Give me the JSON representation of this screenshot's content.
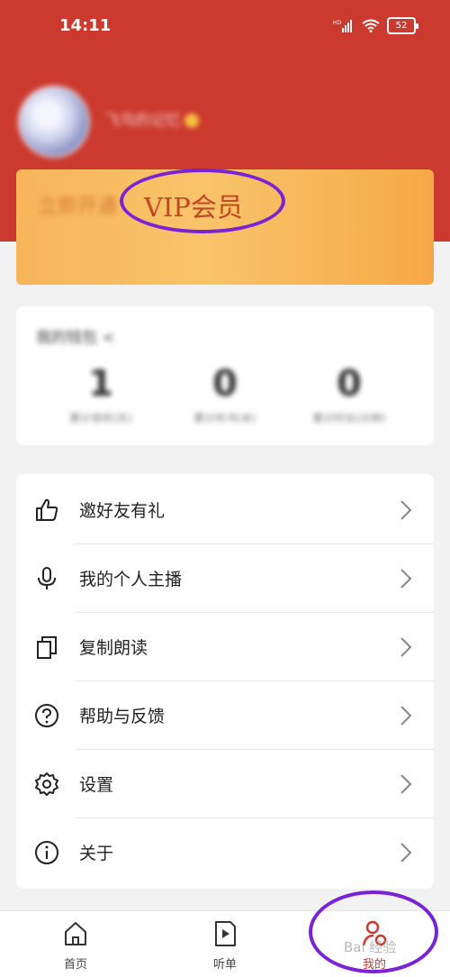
{
  "status_bar": {
    "time": "14:11",
    "network": "HD",
    "battery": "52"
  },
  "profile": {
    "username": "飞鸟的记忆"
  },
  "vip": {
    "blurred_text": "立即开通",
    "label": "VIP会员"
  },
  "stats": {
    "title": "我的钱包 <",
    "items": [
      {
        "value": "1",
        "label": "累计收听(天)"
      },
      {
        "value": "0",
        "label": "累计听书(本)"
      },
      {
        "value": "0",
        "label": "累计时长(分钟)"
      }
    ]
  },
  "menu": [
    {
      "label": "邀好友有礼",
      "icon": "thumbs-up-icon"
    },
    {
      "label": "我的个人主播",
      "icon": "microphone-icon"
    },
    {
      "label": "复制朗读",
      "icon": "copy-icon"
    },
    {
      "label": "帮助与反馈",
      "icon": "help-circle-icon"
    },
    {
      "label": "设置",
      "icon": "gear-icon"
    },
    {
      "label": "关于",
      "icon": "info-icon"
    }
  ],
  "nav": {
    "home": "首页",
    "playlist": "听单",
    "me": "我的"
  },
  "watermark": "Bai 经验",
  "colors": {
    "header_red": "#cc3a2f",
    "vip_orange": "#f8b55a",
    "annotation_purple": "#7a22d6"
  }
}
